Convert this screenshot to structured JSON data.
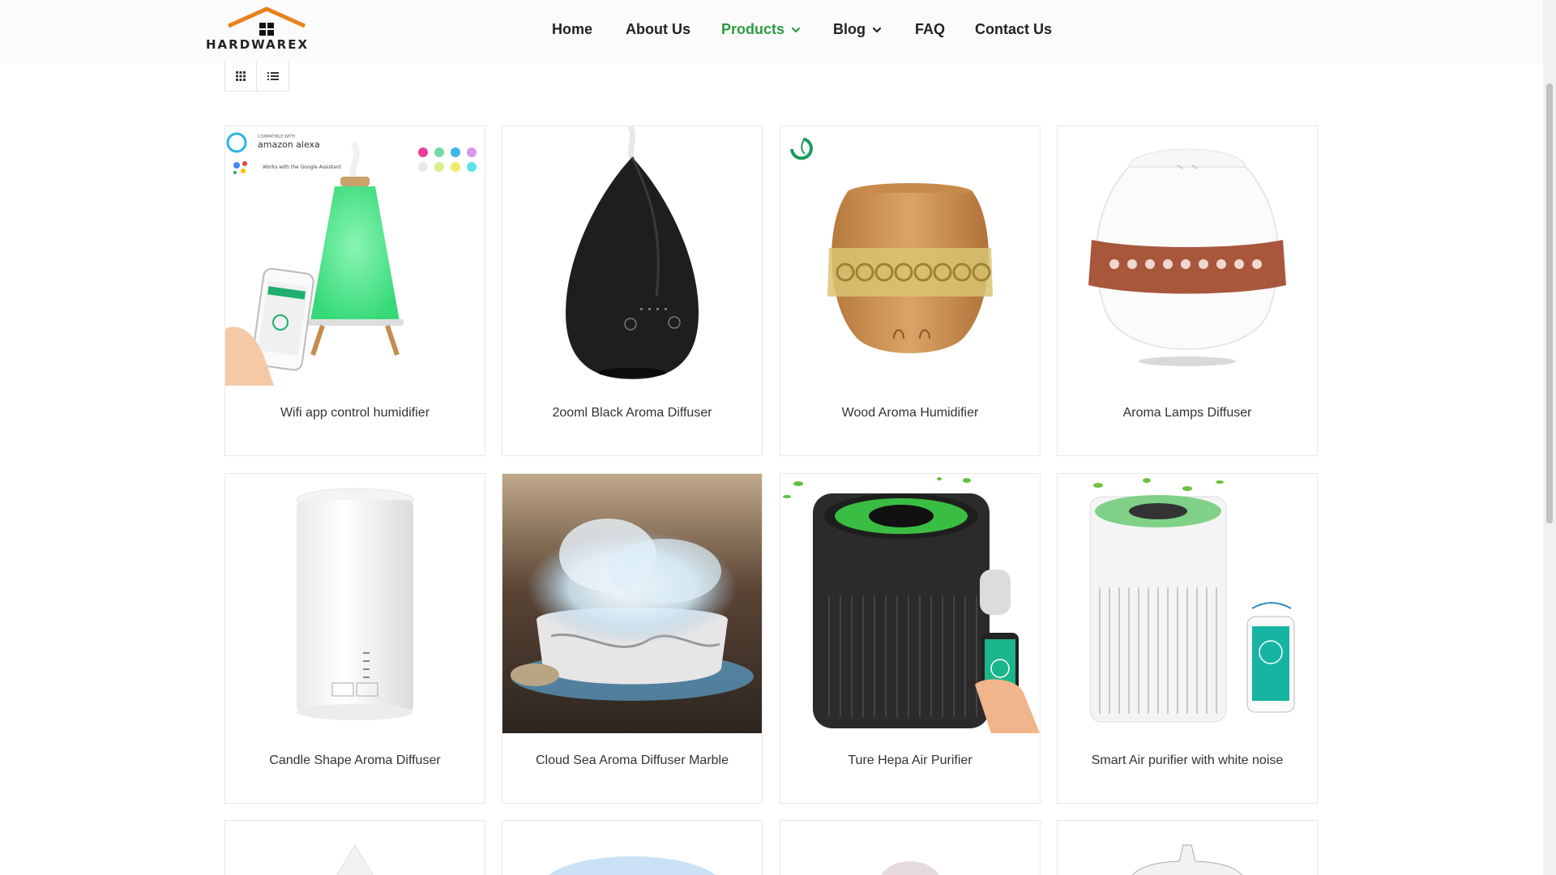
{
  "header": {
    "logo_text": "HARDWAREX",
    "nav": [
      {
        "label": "Home"
      },
      {
        "label": "About Us"
      },
      {
        "label": "Products"
      },
      {
        "label": "Blog"
      },
      {
        "label": "FAQ"
      },
      {
        "label": "Contact Us"
      }
    ]
  },
  "view_toggle": {
    "grid_icon": "grid-icon",
    "list_icon": "list-icon"
  },
  "colors": {
    "accent": "#2e9b43",
    "logo_roof": "#e8811a",
    "text": "#222222"
  },
  "product_badges": {
    "alexa_compat": "COMPATIBLE WITH",
    "alexa": "amazon alexa",
    "google": "Works with the Google Assistant"
  },
  "products": [
    {
      "title": "Wifi app control humidifier"
    },
    {
      "title": "2ooml Black Aroma Diffuser"
    },
    {
      "title": "Wood Aroma Humidifier"
    },
    {
      "title": "Aroma Lamps Diffuser"
    },
    {
      "title": "Candle Shape Aroma Diffuser"
    },
    {
      "title": "Cloud Sea Aroma Diffuser Marble"
    },
    {
      "title": "Ture Hepa Air Purifier"
    },
    {
      "title": "Smart Air purifier with white noise"
    }
  ]
}
